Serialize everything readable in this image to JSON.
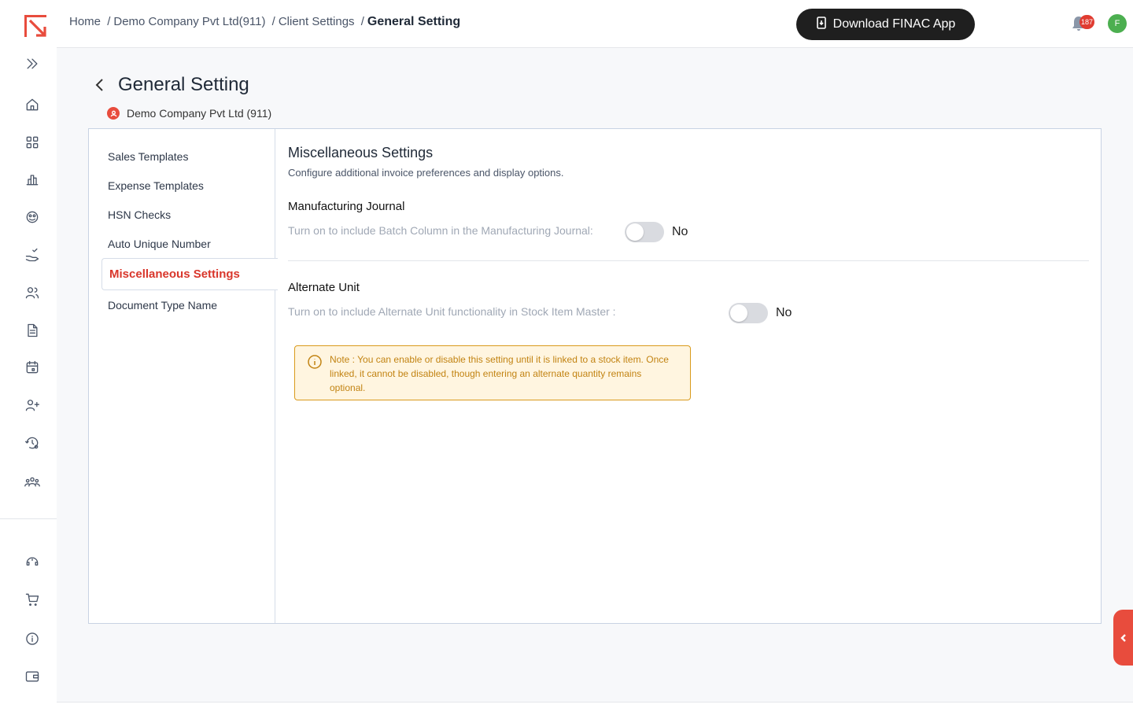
{
  "header": {
    "breadcrumb": {
      "home": "Home",
      "company": "Demo Company Pvt Ltd(911)",
      "client_settings": "Client Settings",
      "current": "General Setting"
    },
    "download_button": "Download FINAC App",
    "notification_count": "187",
    "avatar_initial": "F"
  },
  "page": {
    "title": "General Setting",
    "company": "Demo Company Pvt Ltd (911)"
  },
  "nav": {
    "items": [
      "Sales Templates",
      "Expense Templates",
      "HSN Checks",
      "Auto Unique Number",
      "Miscellaneous Settings",
      "Document Type Name"
    ],
    "active": "Miscellaneous Settings"
  },
  "content": {
    "title": "Miscellaneous Settings",
    "subtitle": "Configure additional invoice preferences and display options.",
    "manufacturing": {
      "title": "Manufacturing Journal",
      "description": "Turn on to include Batch Column in the Manufacturing Journal:",
      "state": "No"
    },
    "alternate_unit": {
      "title": "Alternate Unit",
      "description": "Turn on to include Alternate Unit functionality in Stock Item Master :",
      "state": "No"
    },
    "note": "Note : You can enable or disable this setting until it is linked to a stock item. Once linked, it cannot be disabled, though entering an alternate quantity remains optional."
  },
  "colors": {
    "accent": "#d9362b",
    "note_text": "#c28312",
    "note_bg": "#fff5e0"
  },
  "icons": [
    "logo-icon",
    "expand-icon",
    "home-icon",
    "grid-icon",
    "chart-icon",
    "palette-icon",
    "hand-check-icon",
    "users-icon",
    "document-icon",
    "calendar-icon",
    "add-user-icon",
    "history-settings-icon",
    "team-icon",
    "support-icon",
    "cart-icon",
    "info-icon",
    "wallet-icon"
  ]
}
